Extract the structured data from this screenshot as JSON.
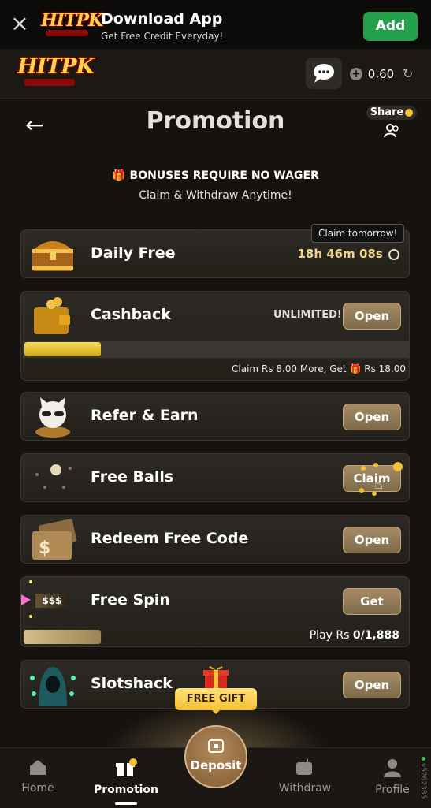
{
  "banner": {
    "title": "Download App",
    "subtitle": "Get Free Credit Everyday!",
    "add_label": "Add",
    "logo_text": "HITPK"
  },
  "header": {
    "logo_text": "HITPK",
    "balance": "0.60"
  },
  "page": {
    "title": "Promotion",
    "share_label": "Share"
  },
  "notice": {
    "headline": "BONUSES REQUIRE NO WAGER",
    "subline": "Claim & Withdraw Anytime!"
  },
  "promos": {
    "daily": {
      "title": "Daily Free",
      "tooltip": "Claim tomorrow!",
      "countdown": "18h 46m 08s"
    },
    "cashback": {
      "title": "Cashback",
      "badge": "UNLIMITED!",
      "button": "Open",
      "progress": 0.2,
      "hint_prefix": "Claim Rs 8.00 More, Get",
      "hint_suffix": "Rs 18.00"
    },
    "refer": {
      "title": "Refer & Earn",
      "button": "Open"
    },
    "balls": {
      "title": "Free Balls",
      "button": "Claim"
    },
    "redeem": {
      "title": "Redeem Free Code",
      "button": "Open"
    },
    "spin": {
      "title": "Free Spin",
      "button": "Get",
      "icon_text": "$$$",
      "progress": 0.2,
      "play_prefix": "Play Rs",
      "play_value": "0/1,888"
    },
    "slotshack": {
      "title": "Slotshack",
      "button": "Open"
    }
  },
  "free_gift_label": "FREE GIFT",
  "nav": {
    "home": "Home",
    "promotion": "Promotion",
    "deposit": "Deposit",
    "withdraw": "Withdraw",
    "profile": "Profile"
  },
  "version": "v5262385",
  "colors": {
    "accent_gold": "#f5c033",
    "countdown_gold": "#f0d38a",
    "add_green": "#23a04c",
    "button_gold": "#8f7856"
  }
}
